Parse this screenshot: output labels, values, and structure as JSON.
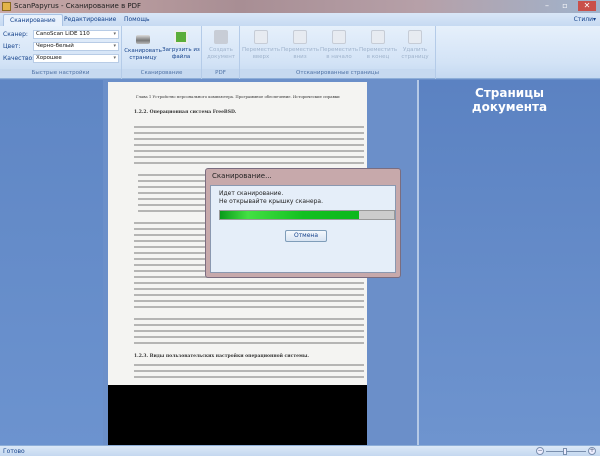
{
  "window": {
    "title": "ScanPapyrus - Сканирование в PDF",
    "minimize": "–",
    "maximize": "▫",
    "close": "✕"
  },
  "tabs": [
    {
      "label": "Сканирование"
    },
    {
      "label": "Редактирование"
    },
    {
      "label": "Помощь"
    }
  ],
  "styles_label": "Стили▾",
  "quick_settings": {
    "label": "Быстрые настройки",
    "scanner_label": "Сканер:",
    "scanner_value": "CanoScan LiDE 110",
    "color_label": "Цвет:",
    "color_value": "Черно-белый",
    "quality_label": "Качество:",
    "quality_value": "Хорошее"
  },
  "scan_group": {
    "label": "Сканирование",
    "scan_page": "Сканировать страницу",
    "load_file": "Загрузить из файла"
  },
  "pdf_group": {
    "label": "PDF",
    "create": "Создать документ"
  },
  "pages_group": {
    "label": "Отсканированные страницы",
    "up": "Переместить вверх",
    "down": "Переместить вниз",
    "to_start": "Переместить в начало",
    "to_end": "Переместить в конец",
    "delete": "Удалить страницу"
  },
  "document": {
    "header": "Глава 1 Устройство персонального компьютера. Программное обеспечение. Исторические справки",
    "section": "1.2.2. Операционная система FreeBSD.",
    "section2": "1.2.3. Виды пользовательских настройки операционной системы."
  },
  "right_panel": {
    "title": "Страницы документа"
  },
  "dialog": {
    "title": "Сканирование...",
    "line1": "Идет сканирование.",
    "line2": "Не открывайте крышку сканера.",
    "progress": 80,
    "cancel": "Отмена"
  },
  "status": {
    "text": "Готово",
    "zoom_minus": "−",
    "zoom_plus": "+"
  }
}
